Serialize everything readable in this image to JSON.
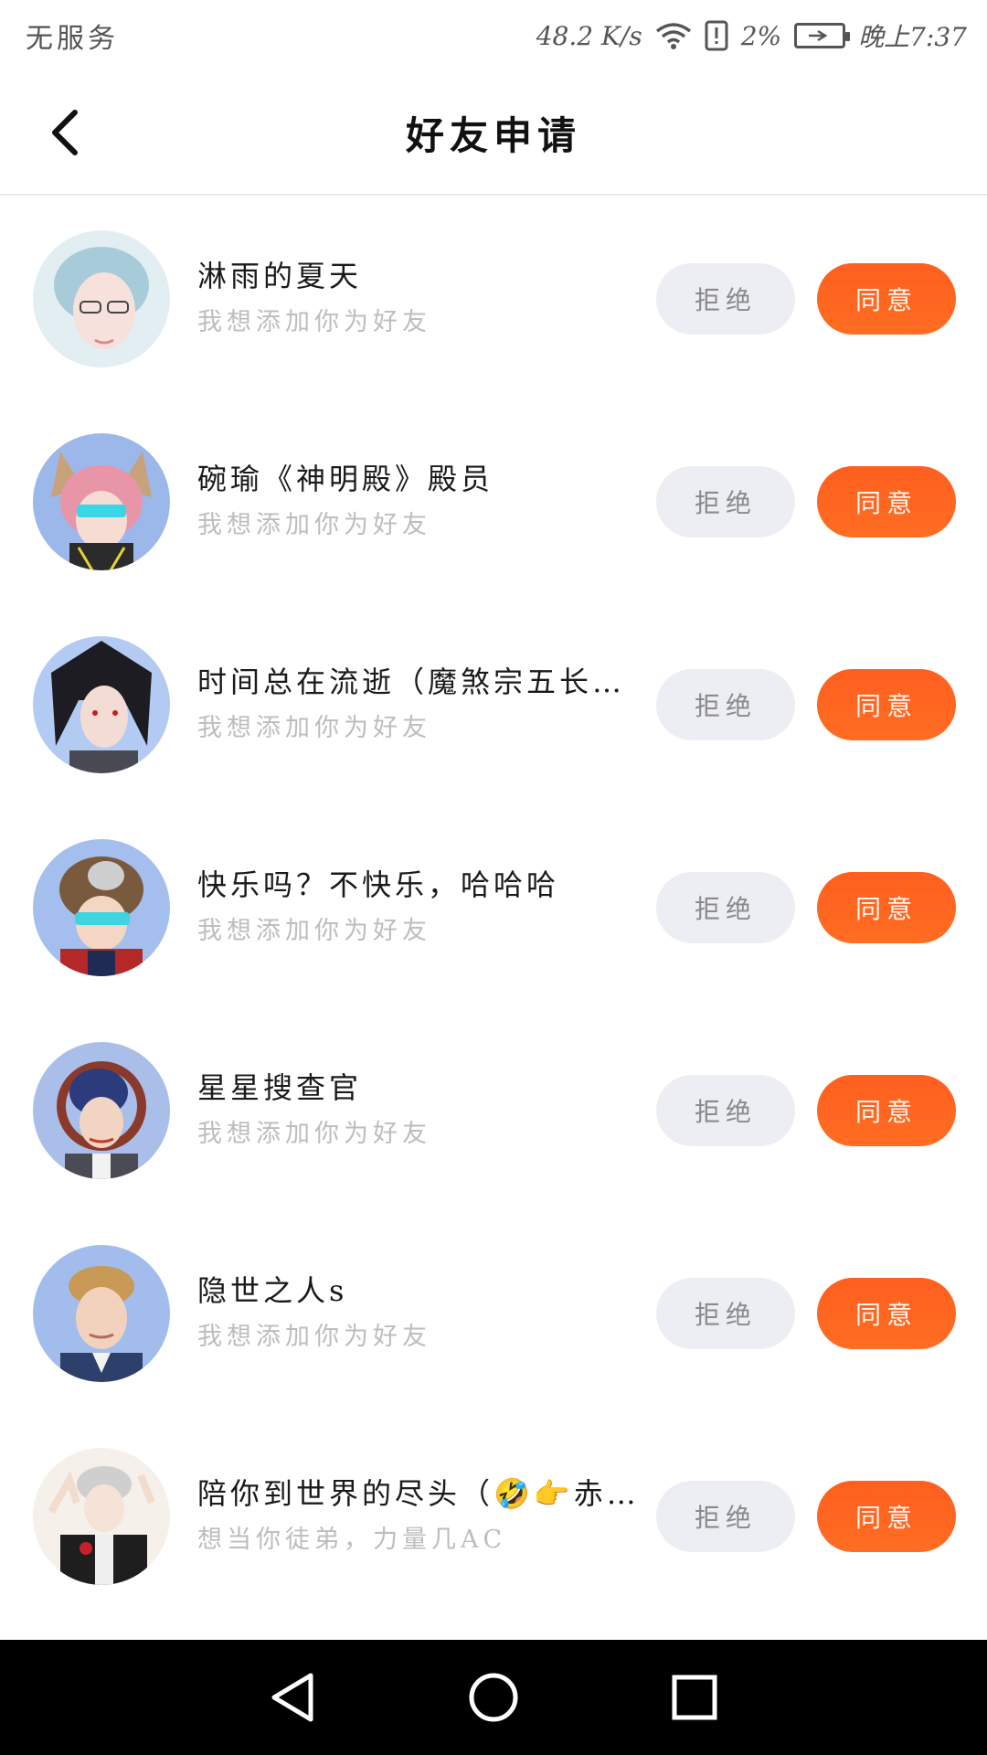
{
  "status_bar": {
    "carrier": "无服务",
    "speed": "48.2 K/s",
    "battery_percent": "2%",
    "time": "晚上7:37"
  },
  "header": {
    "title": "好友申请"
  },
  "requests": [
    {
      "name": "淋雨的夏天",
      "message": "我想添加你为好友",
      "reject_label": "拒绝",
      "accept_label": "同意",
      "avatar_colors": [
        "#cfe3ea",
        "#9fc6d6",
        "#f3d7d2"
      ]
    },
    {
      "name": "碗瑜《神明殿》殿员",
      "message": "我想添加你为好友",
      "reject_label": "拒绝",
      "accept_label": "同意",
      "avatar_colors": [
        "#8eaee6",
        "#e58fa3",
        "#3a2c2c"
      ]
    },
    {
      "name": "时间总在流逝（魔煞宗五长…",
      "message": "我想添加你为好友",
      "reject_label": "拒绝",
      "accept_label": "同意",
      "avatar_colors": [
        "#a9c4f0",
        "#1c1c22",
        "#f1d6cf"
      ]
    },
    {
      "name": "快乐吗？不快乐，哈哈哈",
      "message": "我想添加你为好友",
      "reject_label": "拒绝",
      "accept_label": "同意",
      "avatar_colors": [
        "#9cbbe9",
        "#6b4a32",
        "#b32424"
      ]
    },
    {
      "name": "星星搜查官",
      "message": "我想添加你为好友",
      "reject_label": "拒绝",
      "accept_label": "同意",
      "avatar_colors": [
        "#9cb6e6",
        "#2f3f7a",
        "#f0d2c0"
      ]
    },
    {
      "name": "隐世之人s",
      "message": "我想添加你为好友",
      "reject_label": "拒绝",
      "accept_label": "同意",
      "avatar_colors": [
        "#95b4ea",
        "#c99a55",
        "#2d3f6b"
      ]
    },
    {
      "name": "陪你到世界的尽头（🤣👉赤…",
      "message": "想当你徒弟，力量几AC",
      "reject_label": "拒绝",
      "accept_label": "同意",
      "avatar_colors": [
        "#f4efe8",
        "#c9c9c9",
        "#1e1e1e"
      ]
    }
  ],
  "nav": {
    "back_icon": "triangle-back-icon",
    "home_icon": "circle-home-icon",
    "recents_icon": "square-recents-icon"
  }
}
